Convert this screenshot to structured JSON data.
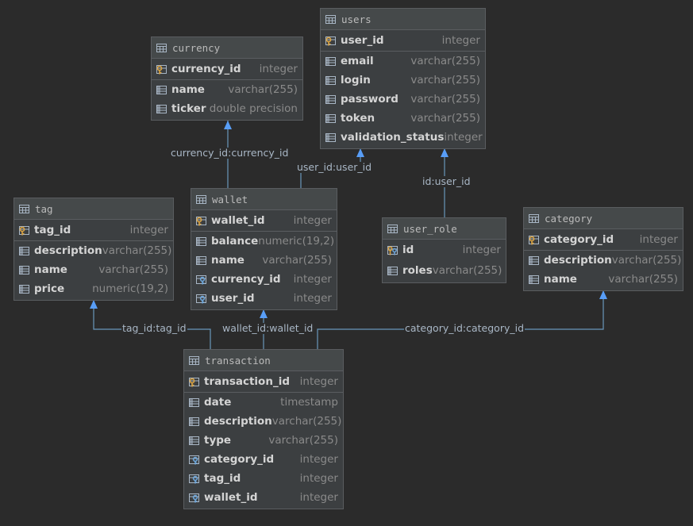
{
  "tables": [
    {
      "id": "users",
      "title": "users",
      "pk": [
        {
          "name": "user_id",
          "type": "integer",
          "icon": "primary-key-icon"
        }
      ],
      "columns": [
        {
          "name": "email",
          "type": "varchar(255)",
          "icon": "column-icon"
        },
        {
          "name": "login",
          "type": "varchar(255)",
          "icon": "column-icon"
        },
        {
          "name": "password",
          "type": "varchar(255)",
          "icon": "column-icon"
        },
        {
          "name": "token",
          "type": "varchar(255)",
          "icon": "column-icon"
        },
        {
          "name": "validation_status",
          "type": "integer",
          "icon": "column-icon"
        }
      ]
    },
    {
      "id": "currency",
      "title": "currency",
      "pk": [
        {
          "name": "currency_id",
          "type": "integer",
          "icon": "primary-key-icon"
        }
      ],
      "columns": [
        {
          "name": "name",
          "type": "varchar(255)",
          "icon": "column-icon"
        },
        {
          "name": "ticker",
          "type": "double precision",
          "icon": "column-icon"
        }
      ]
    },
    {
      "id": "tag",
      "title": "tag",
      "pk": [
        {
          "name": "tag_id",
          "type": "integer",
          "icon": "primary-key-icon"
        }
      ],
      "columns": [
        {
          "name": "description",
          "type": "varchar(255)",
          "icon": "column-icon"
        },
        {
          "name": "name",
          "type": "varchar(255)",
          "icon": "column-icon"
        },
        {
          "name": "price",
          "type": "numeric(19,2)",
          "icon": "column-icon"
        }
      ]
    },
    {
      "id": "wallet",
      "title": "wallet",
      "pk": [
        {
          "name": "wallet_id",
          "type": "integer",
          "icon": "primary-key-icon"
        }
      ],
      "columns": [
        {
          "name": "balance",
          "type": "numeric(19,2)",
          "icon": "column-icon"
        },
        {
          "name": "name",
          "type": "varchar(255)",
          "icon": "column-icon"
        },
        {
          "name": "currency_id",
          "type": "integer",
          "icon": "foreign-key-icon"
        },
        {
          "name": "user_id",
          "type": "integer",
          "icon": "foreign-key-icon"
        }
      ]
    },
    {
      "id": "user_role",
      "title": "user_role",
      "pk": [
        {
          "name": "id",
          "type": "integer",
          "icon": "primary-foreign-key-icon"
        },
        {
          "name": "roles",
          "type": "varchar(255)",
          "icon": "column-icon"
        }
      ],
      "columns": []
    },
    {
      "id": "category",
      "title": "category",
      "pk": [
        {
          "name": "category_id",
          "type": "integer",
          "icon": "primary-key-icon"
        }
      ],
      "columns": [
        {
          "name": "description",
          "type": "varchar(255)",
          "icon": "column-icon"
        },
        {
          "name": "name",
          "type": "varchar(255)",
          "icon": "column-icon"
        }
      ]
    },
    {
      "id": "transaction",
      "title": "transaction",
      "pk": [
        {
          "name": "transaction_id",
          "type": "integer",
          "icon": "primary-key-icon"
        }
      ],
      "columns": [
        {
          "name": "date",
          "type": "timestamp",
          "icon": "column-icon"
        },
        {
          "name": "description",
          "type": "varchar(255)",
          "icon": "column-icon"
        },
        {
          "name": "type",
          "type": "varchar(255)",
          "icon": "column-icon"
        },
        {
          "name": "category_id",
          "type": "integer",
          "icon": "foreign-key-icon"
        },
        {
          "name": "tag_id",
          "type": "integer",
          "icon": "foreign-key-icon"
        },
        {
          "name": "wallet_id",
          "type": "integer",
          "icon": "foreign-key-icon"
        }
      ]
    }
  ],
  "relations": [
    {
      "id": "wallet-currency",
      "label": "currency_id:currency_id"
    },
    {
      "id": "wallet-users",
      "label": "user_id:user_id"
    },
    {
      "id": "userrole-users",
      "label": "id:user_id"
    },
    {
      "id": "transaction-tag",
      "label": "tag_id:tag_id"
    },
    {
      "id": "transaction-wallet",
      "label": "wallet_id:wallet_id"
    },
    {
      "id": "transaction-category",
      "label": "category_id:category_id"
    }
  ],
  "colors": {
    "background": "#2b2b2b",
    "edge": "#6897bb",
    "arrow": "#589df6",
    "key_gold": "#d9a343",
    "key_blue": "#6fa8dc"
  }
}
